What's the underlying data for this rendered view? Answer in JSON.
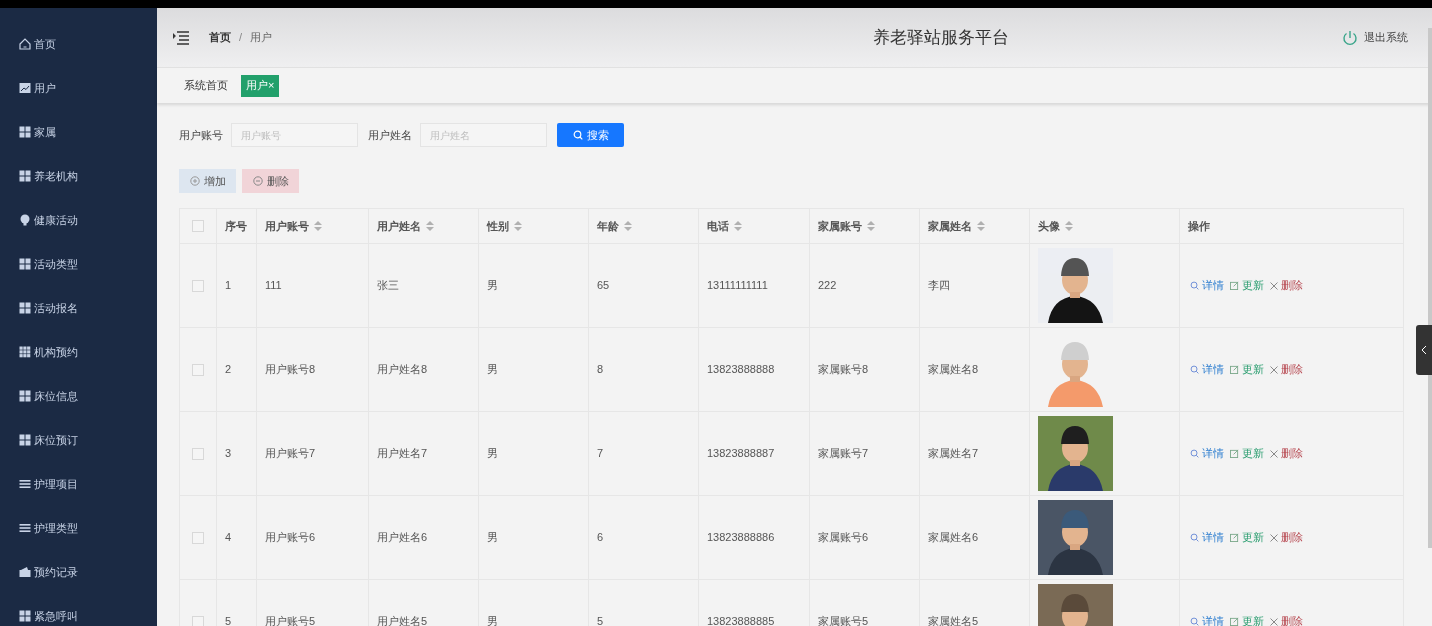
{
  "sidebar": {
    "items": [
      {
        "label": "首页",
        "selected": false
      },
      {
        "label": "用户",
        "selected": false
      },
      {
        "label": "家属",
        "selected": false
      },
      {
        "label": "养老机构",
        "selected": false
      },
      {
        "label": "健康活动",
        "selected": false
      },
      {
        "label": "活动类型",
        "selected": false
      },
      {
        "label": "活动报名",
        "selected": false
      },
      {
        "label": "机构预约",
        "selected": false
      },
      {
        "label": "床位信息",
        "selected": false
      },
      {
        "label": "床位预订",
        "selected": false
      },
      {
        "label": "护理项目",
        "selected": false
      },
      {
        "label": "护理类型",
        "selected": false
      },
      {
        "label": "预约记录",
        "selected": false
      },
      {
        "label": "紧急呼叫",
        "selected": false
      }
    ]
  },
  "header": {
    "breadcrumb": [
      "首页",
      "/",
      "用户"
    ],
    "title": "养老驿站服务平台",
    "logout": "退出系统"
  },
  "tabs": [
    {
      "label": "系统首页",
      "selected": false
    },
    {
      "label": "用户",
      "selected": true,
      "close": "×"
    }
  ],
  "search": {
    "fields": [
      {
        "label": "用户账号",
        "placeholder": "用户账号"
      },
      {
        "label": "用户姓名",
        "placeholder": "用户姓名"
      }
    ],
    "button": "搜索"
  },
  "actions": {
    "add": "增加",
    "delete": "删除"
  },
  "table": {
    "header_checked": false,
    "columns": [
      {
        "label": "序号",
        "sortable": false
      },
      {
        "label": "用户账号",
        "sortable": true
      },
      {
        "label": "用户姓名",
        "sortable": true
      },
      {
        "label": "性别",
        "sortable": true
      },
      {
        "label": "年龄",
        "sortable": true
      },
      {
        "label": "电话",
        "sortable": true
      },
      {
        "label": "家属账号",
        "sortable": true
      },
      {
        "label": "家属姓名",
        "sortable": true
      },
      {
        "label": "头像",
        "sortable": true
      },
      {
        "label": "操作",
        "sortable": false
      }
    ],
    "rows": [
      {
        "checked": false,
        "cells": [
          "1",
          "111",
          "张三",
          "男",
          "65",
          "13111111111",
          "222",
          "李四"
        ],
        "actions": {
          "detail": "详情",
          "update": "更新",
          "delete": "删除"
        }
      },
      {
        "checked": false,
        "cells": [
          "2",
          "用户账号8",
          "用户姓名8",
          "男",
          "8",
          "13823888888",
          "家属账号8",
          "家属姓名8"
        ],
        "actions": {
          "detail": "详情",
          "update": "更新",
          "delete": "删除"
        }
      },
      {
        "checked": false,
        "cells": [
          "3",
          "用户账号7",
          "用户姓名7",
          "男",
          "7",
          "13823888887",
          "家属账号7",
          "家属姓名7"
        ],
        "actions": {
          "detail": "详情",
          "update": "更新",
          "delete": "删除"
        }
      },
      {
        "checked": false,
        "cells": [
          "4",
          "用户账号6",
          "用户姓名6",
          "男",
          "6",
          "13823888886",
          "家属账号6",
          "家属姓名6"
        ],
        "actions": {
          "detail": "详情",
          "update": "更新",
          "delete": "删除"
        }
      },
      {
        "checked": false,
        "cells": [
          "5",
          "用户账号5",
          "用户姓名5",
          "男",
          "5",
          "13823888885",
          "家属账号5",
          "家属姓名5"
        ],
        "actions": {
          "detail": "详情",
          "update": "更新",
          "delete": "删除"
        }
      }
    ]
  }
}
